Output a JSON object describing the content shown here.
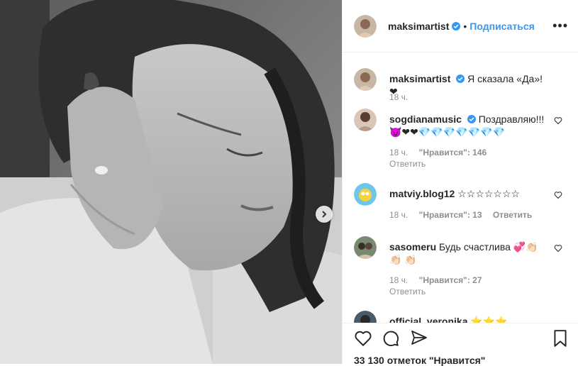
{
  "post": {
    "author": "maksimartist",
    "follow_label": "Подписаться",
    "more_label": "•••",
    "caption": "Я сказала «Да»!❤",
    "caption_time": "18 ч.",
    "likes": "33 130 отметок \"Нравится\""
  },
  "comments": [
    {
      "user": "sogdianamusic",
      "text": "Поздравляю!!! 😈❤❤💎💎💎💎💎💎💎",
      "time": "18 ч.",
      "likes": "\"Нравится\": 146",
      "reply": "Ответить"
    },
    {
      "user": "matviy.blog12",
      "text": "☆☆☆☆☆☆☆",
      "time": "18 ч.",
      "likes": "\"Нравится\": 13",
      "reply": "Ответить"
    },
    {
      "user": "sasomeru",
      "text": "Будь счастлива 💞👏🏻👏🏻 👏🏻",
      "time": "18 ч.",
      "likes": "\"Нравится\": 27",
      "reply": "Ответить"
    },
    {
      "user": "official_veronika",
      "text": "⭐⭐⭐"
    }
  ],
  "colors": {
    "accent": "#3897f0",
    "verified": "#3897f0",
    "muted": "#8e8e8e"
  },
  "icons": [
    "chevron-right-icon",
    "verified-icon",
    "heart-icon",
    "comment-icon",
    "bookmark-icon"
  ]
}
